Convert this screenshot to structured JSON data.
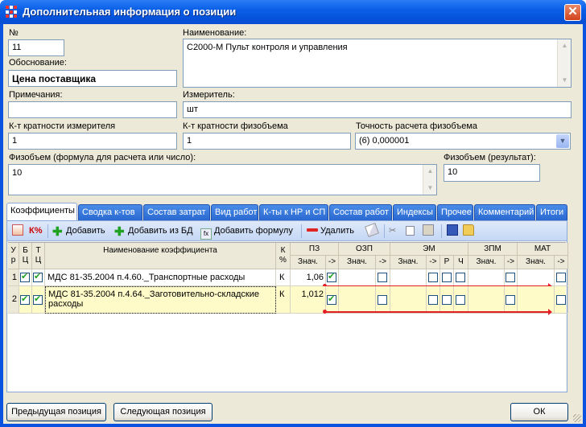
{
  "window": {
    "title": "Дополнительная информация о позиции",
    "close_glyph": "✕",
    "icon": "grid-app-icon"
  },
  "form": {
    "number_label": "№",
    "number_value": "11",
    "name_label": "Наименование:",
    "name_value": "С2000-М Пульт контроля и управления",
    "basis_label": "Обоснование:",
    "basis_value": "Цена поставщика",
    "notes_label": "Примечания:",
    "notes_value": "",
    "unit_label": "Измеритель:",
    "unit_value": "шт",
    "unit_mult_label": "К-т кратности измерителя",
    "unit_mult_value": "1",
    "vol_mult_label": "К-т кратности физобъема",
    "vol_mult_value": "1",
    "precision_label": "Точность расчета физобъема",
    "precision_value": "(6) 0,000001",
    "formula_label": "Физобъем (формула для расчета или число):",
    "formula_value": "10",
    "result_label": "Физобъем (результат):",
    "result_value": "10"
  },
  "tabs": [
    "Коэффициенты",
    "Сводка к-тов",
    "Состав затрат",
    "Вид работ",
    "К-ты к НР и СП",
    "Состав работ",
    "Индексы",
    "Прочее",
    "Комментарий",
    "Итоги"
  ],
  "toolbar": {
    "k_pct": "К%",
    "add": "Добавить",
    "add_db": "Добавить из БД",
    "add_formula": "Добавить формулу",
    "delete": "Удалить"
  },
  "grid": {
    "headers": {
      "ur": "У\nр",
      "bc": "Б\nЦ",
      "tc": "Т\nЦ",
      "name": "Наименование коэффициента",
      "kpct": "К\n%",
      "pz": "ПЗ",
      "ozp": "ОЗП",
      "em": "ЭМ",
      "zpm": "ЗПМ",
      "mat": "МАТ",
      "val": "Знач.",
      "arrow": "->",
      "r": "Р",
      "ch": "Ч"
    },
    "rows": [
      {
        "ur": "1",
        "bc": true,
        "tc": true,
        "name": "МДС 81-35.2004 п.4.60._Транспортные расходы",
        "k": "К",
        "pz": "1,06"
      },
      {
        "ur": "2",
        "bc": true,
        "tc": true,
        "name": "МДС 81-35.2004 п.4.64._Заготовительно-складские расходы",
        "k": "К",
        "pz": "1,012"
      }
    ]
  },
  "buttons": {
    "prev": "Предыдущая позиция",
    "next": "Следующая позиция",
    "ok": "ОК"
  },
  "colors": {
    "selected_row": "#fffbc8",
    "flow_line": "#e41e26"
  }
}
